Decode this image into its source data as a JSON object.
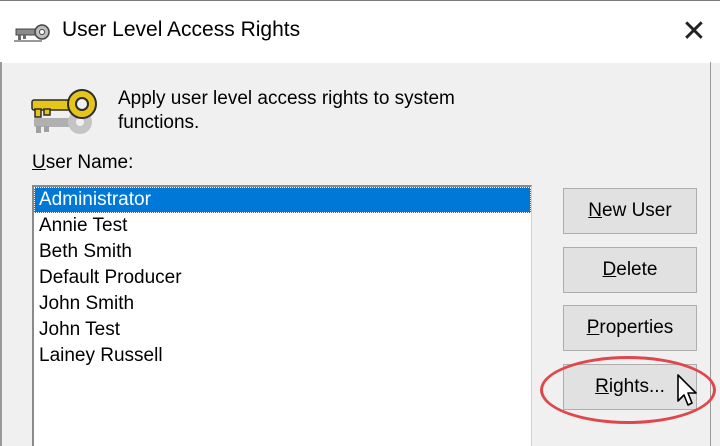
{
  "window": {
    "title": "User Level Access Rights",
    "close_glyph": "✕",
    "title_icon": "key-icon"
  },
  "content": {
    "description": "Apply user level access rights to system functions.",
    "main_icon": "keys-icon",
    "user_name_label_accel": "U",
    "user_name_label_rest": "ser Name:"
  },
  "users": {
    "selected": "Administrator",
    "items": [
      "Administrator",
      "Annie Test",
      "Beth Smith",
      "Default Producer",
      "John Smith",
      "John Test",
      "Lainey Russell"
    ]
  },
  "buttons": {
    "new_user": {
      "accel": "N",
      "rest": "ew User"
    },
    "delete": {
      "accel": "D",
      "rest": "elete"
    },
    "properties": {
      "accel": "P",
      "rest": "roperties"
    },
    "rights": {
      "accel": "R",
      "rest": "ights..."
    }
  },
  "annotation": {
    "highlight_color": "#e0474c",
    "highlighted": "rights-button"
  },
  "colors": {
    "selection": "#0078d7",
    "dialog_bg": "#f0f0f0",
    "button_bg": "#e1e1e1"
  }
}
